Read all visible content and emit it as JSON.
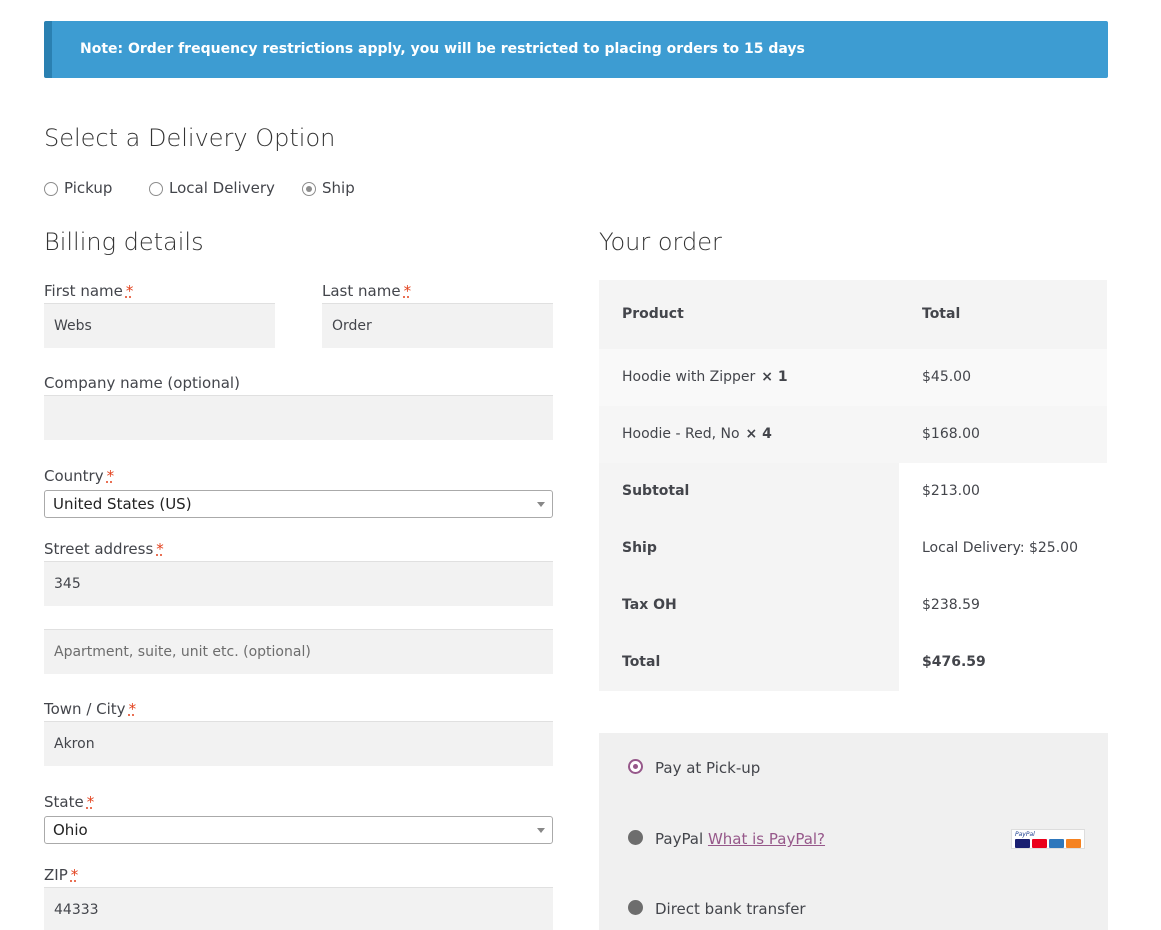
{
  "notice": {
    "text": "Note: Order frequency restrictions apply, you will be restricted to placing orders to 15 days"
  },
  "delivery": {
    "title": "Select a Delivery Option",
    "options": [
      {
        "label": "Pickup",
        "checked": false
      },
      {
        "label": "Local Delivery",
        "checked": false
      },
      {
        "label": "Ship",
        "checked": true
      }
    ]
  },
  "billing": {
    "title": "Billing details",
    "required_mark": "*",
    "first_name": {
      "label": "First name",
      "value": "Webs"
    },
    "last_name": {
      "label": "Last name",
      "value": "Order"
    },
    "company": {
      "label": "Company name (optional)",
      "value": ""
    },
    "country": {
      "label": "Country",
      "value": "United States (US)"
    },
    "street": {
      "label": "Street address",
      "value": "345",
      "placeholder2": "Apartment, suite, unit etc. (optional)"
    },
    "city": {
      "label": "Town / City",
      "value": "Akron"
    },
    "state": {
      "label": "State",
      "value": "Ohio"
    },
    "zip": {
      "label": "ZIP",
      "value": "44333"
    }
  },
  "order": {
    "title": "Your order",
    "headers": {
      "product": "Product",
      "total": "Total"
    },
    "items": [
      {
        "name": "Hoodie with Zipper",
        "qty": "× 1",
        "total": "$45.00"
      },
      {
        "name": "Hoodie - Red, No",
        "qty": "× 4",
        "total": "$168.00"
      }
    ],
    "subtotal": {
      "label": "Subtotal",
      "value": "$213.00"
    },
    "ship": {
      "label": "Ship",
      "value": "Local Delivery: $25.00"
    },
    "tax": {
      "label": "Tax OH",
      "value": "$238.59"
    },
    "total": {
      "label": "Total",
      "value": "$476.59"
    }
  },
  "payment": {
    "methods": [
      {
        "label": "Pay at Pick-up",
        "selected": true
      },
      {
        "label": "PayPal",
        "link": "What is PayPal?",
        "selected": false
      },
      {
        "label": "Direct bank transfer",
        "selected": false
      }
    ],
    "paypal_logo_text": "PayPal"
  },
  "colors": {
    "notice_bg": "#3d9cd2",
    "accent": "#96588a",
    "required": "#e2401c"
  },
  "icons": [
    "radio-icon",
    "caret-down-icon",
    "card-logos-icon"
  ]
}
